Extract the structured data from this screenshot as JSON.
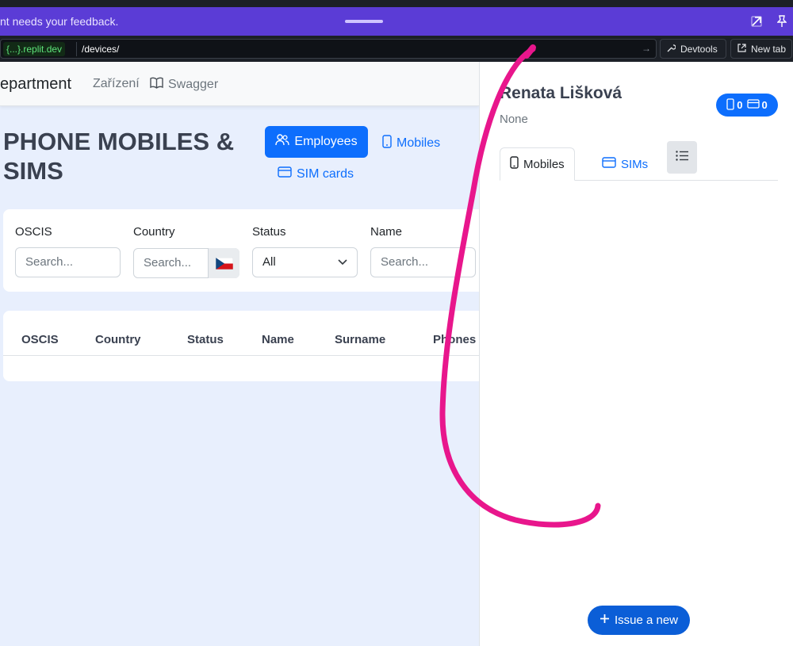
{
  "banner": {
    "text": "nt needs your feedback.",
    "popout_icon": "external-link-icon",
    "pin_icon": "pin-icon"
  },
  "urlbar": {
    "domain": "{...}.replit.dev",
    "path": "/devices/",
    "devtools_label": "Devtools",
    "newtab_label": "New tab"
  },
  "navbar": {
    "brand": "epartment",
    "links": [
      {
        "label": "Zařízení"
      },
      {
        "label": "Swagger",
        "icon": "book-icon"
      }
    ]
  },
  "main": {
    "title": "PHONE MOBILES & SIMS",
    "buttons": {
      "employees": "Employees",
      "mobiles": "Mobiles",
      "sim_cards": "SIM cards"
    }
  },
  "filters": [
    {
      "label": "OSCIS",
      "placeholder": "Search..."
    },
    {
      "label": "Country",
      "placeholder": "Search..."
    },
    {
      "label": "Status",
      "value": "All"
    },
    {
      "label": "Name",
      "placeholder": "Search..."
    }
  ],
  "table": {
    "columns": [
      "OSCIS",
      "Country",
      "Status",
      "Name",
      "Surname",
      "Phones"
    ]
  },
  "panel": {
    "name": "Renata Lišková",
    "subtitle": "None",
    "counts": {
      "mobiles": "0",
      "sims": "0"
    },
    "tabs": [
      {
        "label": "Mobiles",
        "active": true
      },
      {
        "label": "SIMs",
        "active": false
      }
    ],
    "issue_button": "Issue a new"
  },
  "colors": {
    "accent": "#0d6efd",
    "banner": "#5b3cd6",
    "annotation": "#e8168c"
  }
}
